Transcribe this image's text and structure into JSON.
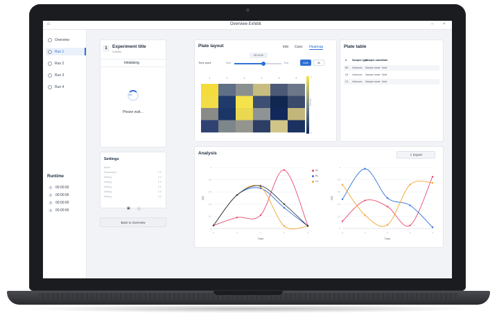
{
  "window": {
    "title": "Overview Exhibit",
    "minimize": "–",
    "close": "×"
  },
  "sidebar": {
    "items": [
      {
        "label": "Overview",
        "icon": "menu-icon",
        "active": false
      },
      {
        "label": "Run 1",
        "icon": "run-icon",
        "active": true
      },
      {
        "label": "Run 2",
        "icon": "run-icon",
        "active": false
      },
      {
        "label": "Run 3",
        "icon": "run-icon",
        "active": false
      },
      {
        "label": "Run 4",
        "icon": "run-icon",
        "active": false
      }
    ],
    "recent_title": "Runtime",
    "runs": [
      {
        "n": "1",
        "time": "00:00:00"
      },
      {
        "n": "2",
        "time": "00:00:00"
      },
      {
        "n": "3",
        "time": "00:00:00"
      },
      {
        "n": "4",
        "time": "00:00:00"
      }
    ]
  },
  "experiment": {
    "number": "1",
    "title": "Experiment title",
    "subtitle": "Subtitle",
    "status": "Initializing",
    "spinner_label": "0%",
    "wait_text": "Please wait...",
    "settings_title": "Settings",
    "settings_rows": [
      {
        "k": "Name",
        "v": ""
      },
      {
        "k": "Parameters",
        "v": "0.0"
      },
      {
        "k": "Setting",
        "v": "0.0"
      },
      {
        "k": "Setting",
        "v": "0.0"
      },
      {
        "k": "Setting",
        "v": "0.0"
      },
      {
        "k": "Setting",
        "v": "0.0"
      },
      {
        "k": "Setting",
        "v": "0.0"
      }
    ],
    "back_label": "Back to Overview"
  },
  "plate": {
    "title": "Plate layout",
    "tabs": [
      "Info",
      "Conc",
      "Heatmap"
    ],
    "active_tab": 2,
    "timepoint_label": "Time point",
    "slider_min": "Start",
    "slider_max": "End",
    "slider_tip": "00:10:00",
    "slider_value": 0.62,
    "btn_primary": "Live",
    "btn_secondary": "All",
    "col_labels": [
      "1",
      "2",
      "3",
      "4",
      "5",
      "6"
    ],
    "row_labels": [
      "A",
      "B",
      "C",
      "D"
    ],
    "colorbar_label": "Intensity",
    "colorbar_top": "1",
    "colorbar_bottom": "0",
    "cells": [
      [
        "#f3dc3c",
        "#5f6f86",
        "#8a8f90",
        "#c8bd80",
        "#4c5a78",
        "#6c778a"
      ],
      [
        "#f2dc48",
        "#1f3b6b",
        "#f4e34a",
        "#3d4f72",
        "#10274f",
        "#3a4a6b"
      ],
      [
        "#8a8a86",
        "#1b3566",
        "#e9d850",
        "#8e9394",
        "#12285a",
        "#c3b67a"
      ],
      [
        "#2f4272",
        "#7d8689",
        "#93958e",
        "#2c3e66",
        "#d0c589",
        "#1b315f"
      ]
    ]
  },
  "plate_table": {
    "title": "Plate table",
    "headers": [
      "#",
      "Sample type",
      "Sample name",
      "Note"
    ],
    "rows": [
      [
        "B3",
        "Unknown",
        "Sample name",
        "Note"
      ],
      [
        "D4",
        "Unknown",
        "Sample name",
        "Note"
      ],
      [
        "C1",
        "Unknown",
        "Sample name",
        "Note"
      ]
    ]
  },
  "analysis": {
    "title": "Analysis",
    "export_label": "Export"
  },
  "chart_data": [
    {
      "type": "line",
      "title": "",
      "xlabel": "Time",
      "ylabel": "OD",
      "x": [
        0,
        1,
        2,
        3,
        4
      ],
      "xticks": [
        "0",
        "1",
        "2",
        "3",
        "4"
      ],
      "ylim": [
        0,
        1
      ],
      "yticks": [
        "0",
        "0.2",
        "0.4",
        "0.6",
        "0.8",
        "1"
      ],
      "legend": "right",
      "series": [
        {
          "name": "A1",
          "color": "#e8476a",
          "values": [
            0.05,
            0.18,
            0.22,
            0.96,
            0.05
          ]
        },
        {
          "name": "B1",
          "color": "#2f6fd6",
          "values": [
            0.05,
            0.55,
            0.66,
            0.34,
            0.04
          ]
        },
        {
          "name": "C1",
          "color": "#f4a52f",
          "values": [
            0.05,
            0.55,
            0.68,
            0.04,
            0.04
          ]
        },
        {
          "name": "",
          "color": "#333a44",
          "values": [
            0.05,
            0.55,
            0.7,
            0.4,
            0.04
          ]
        }
      ]
    },
    {
      "type": "line",
      "title": "",
      "xlabel": "Time",
      "ylabel": "OD",
      "x": [
        0,
        1,
        2,
        3,
        4
      ],
      "xticks": [
        "0",
        "1",
        "2",
        "3",
        "4"
      ],
      "ylim": [
        0,
        1
      ],
      "yticks": [
        "0",
        "0.2",
        "0.4",
        "0.6",
        "0.8",
        "1"
      ],
      "series": [
        {
          "name": "A1",
          "color": "#e8476a",
          "values": [
            0.12,
            0.46,
            0.36,
            0.05,
            0.85
          ]
        },
        {
          "name": "B1",
          "color": "#2f6fd6",
          "values": [
            0.48,
            0.98,
            0.5,
            0.38,
            0.02
          ]
        },
        {
          "name": "C1",
          "color": "#f4a52f",
          "values": [
            0.72,
            0.22,
            0.06,
            0.72,
            0.75
          ]
        }
      ]
    }
  ]
}
